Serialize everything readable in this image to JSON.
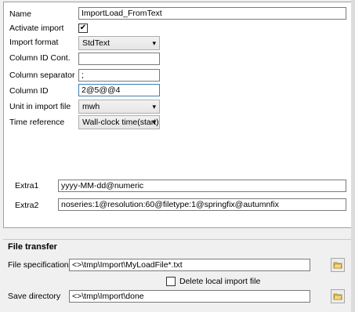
{
  "form": {
    "name": {
      "label": "Name",
      "value": "ImportLoad_FromText"
    },
    "activate": {
      "label": "Activate import",
      "checked_mark": "✔"
    },
    "import_format": {
      "label": "Import format",
      "value": "StdText"
    },
    "column_id_cont": {
      "label": "Column ID Cont.",
      "value": ""
    },
    "column_separator": {
      "label": "Column separator",
      "value": ";"
    },
    "column_id": {
      "label": "Column ID",
      "value": "2@5@@4"
    },
    "unit": {
      "label": "Unit in import file",
      "value": "mwh"
    },
    "time_reference": {
      "label": "Time reference",
      "value": "Wall-clock time(start)"
    },
    "extra1": {
      "label": "Extra1",
      "value": "yyyy-MM-dd@numeric"
    },
    "extra2": {
      "label": "Extra2",
      "value": "noseries:1@resolution:60@filetype:1@springfix@autumnfix"
    }
  },
  "file_transfer": {
    "title": "File transfer",
    "file_spec": {
      "label": "File specification",
      "value": "<>\\tmp\\Import\\MyLoadFile*.txt"
    },
    "delete_local": {
      "label": "Delete local import file"
    },
    "save_dir": {
      "label": "Save directory",
      "value": "<>\\tmp\\Import\\done"
    }
  },
  "icons": {
    "dropdown": "▾"
  }
}
